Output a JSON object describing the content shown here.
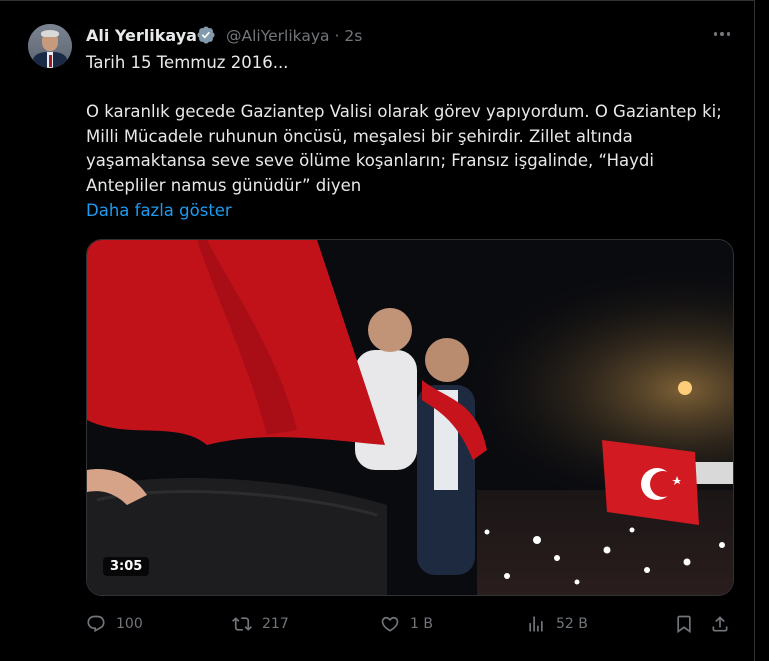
{
  "author": {
    "name": "Ali Yerlikaya",
    "handle": "@AliYerlikaya",
    "time": "2s",
    "separator": "·"
  },
  "tweet": {
    "line1": "Tarih 15 Temmuz 2016...",
    "body": "O karanlık gecede Gaziantep Valisi olarak görev yapıyordum. O Gaziantep ki; Milli Mücadele ruhunun öncüsü, meşalesi bir şehirdir. Zillet altında yaşamaktansa seve seve ölüme koşanların; Fransız işgalinde, “Haydi Antepliler namus günüdür” diyen",
    "show_more": "Daha fazla göster"
  },
  "video": {
    "duration": "3:05"
  },
  "actions": {
    "replies": "100",
    "reposts": "217",
    "likes": "1 B",
    "views": "52 B"
  },
  "colors": {
    "accent": "#1d9bf0",
    "muted": "#71767b",
    "text": "#e7e9ea",
    "background": "#000000"
  },
  "icons": [
    "verified-badge-icon",
    "more-icon",
    "reply-icon",
    "repost-icon",
    "like-icon",
    "views-icon",
    "bookmark-icon",
    "share-icon"
  ]
}
